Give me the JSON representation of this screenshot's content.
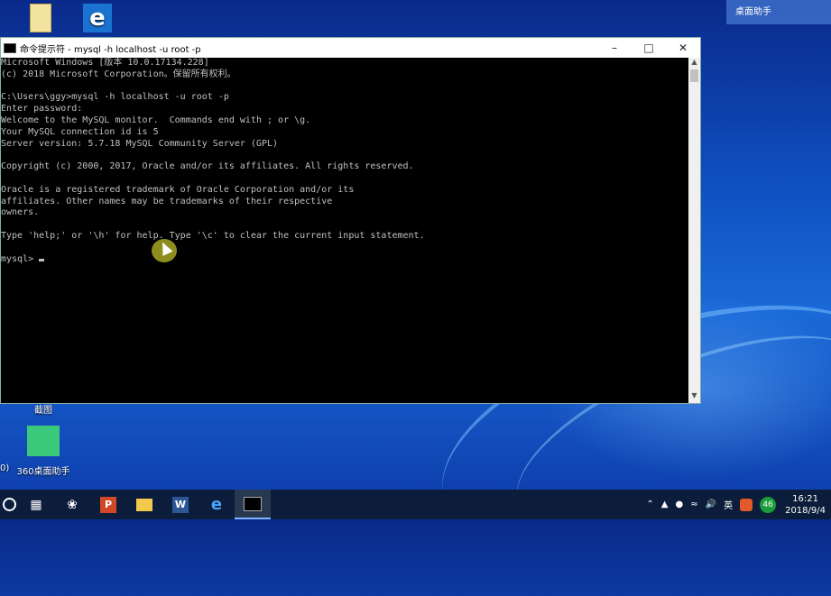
{
  "window": {
    "title": "命令提示符 - mysql  -h localhost -u root -p",
    "console_lines": [
      "Microsoft Windows [版本 10.0.17134.228]",
      "(c) 2018 Microsoft Corporation。保留所有权利。",
      "",
      "C:\\Users\\ggy>mysql -h localhost -u root -p",
      "Enter password:",
      "Welcome to the MySQL monitor.  Commands end with ; or \\g.",
      "Your MySQL connection id is 5",
      "Server version: 5.7.18 MySQL Community Server (GPL)",
      "",
      "Copyright (c) 2000, 2017, Oracle and/or its affiliates. All rights reserved.",
      "",
      "Oracle is a registered trademark of Oracle Corporation and/or its",
      "affiliates. Other names may be trademarks of their respective",
      "owners.",
      "",
      "Type 'help;' or '\\h' for help. Type '\\c' to clear the current input statement.",
      ""
    ],
    "prompt": "mysql> "
  },
  "desktop": {
    "assistant_label": "桌面助手",
    "icons": [
      {
        "label": "截图",
        "icon": "screenshot-icon"
      },
      {
        "label": "360桌面助手",
        "icon": "desktop-assistant-icon"
      },
      {
        "label": "0)",
        "icon": "partial-icon"
      }
    ]
  },
  "taskbar": {
    "items": [
      "start",
      "cortana",
      "task-view",
      "pinwheel",
      "powerpoint",
      "file-explorer",
      "word",
      "edge",
      "cmd"
    ],
    "tray": {
      "ime": "英",
      "badge": "46",
      "time": "16:21",
      "date": "2018/9/4"
    }
  }
}
